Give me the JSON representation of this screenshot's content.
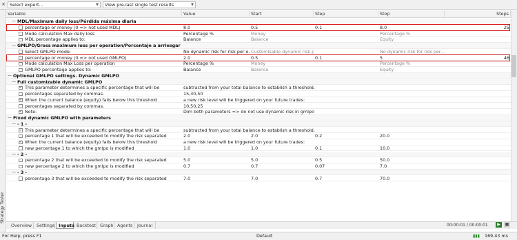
{
  "toolbar": {
    "close_glyph": "×",
    "expert_select": "Select expert...",
    "results_select": "View pre-last single test results"
  },
  "columns": {
    "variable": "Variable",
    "value": "Value",
    "start": "Start",
    "step": "Step",
    "stop": "Stop",
    "steps": "Steps"
  },
  "rows": [
    {
      "type": "group",
      "indent": 1,
      "name": "MDL/Maximum daily loss/Pérdida máxima diaria"
    },
    {
      "type": "param",
      "indent": 2,
      "checked": false,
      "name": "percentage or money (0 => not used MDL)",
      "value": "8.0",
      "start": "0.5",
      "step": "0.1",
      "stop": "8.0",
      "steps": "25",
      "highlight": true
    },
    {
      "type": "param",
      "indent": 2,
      "checked": false,
      "name": "Mode calculation Max daily loss",
      "value": "Percentage %",
      "start": "Money",
      "step": "",
      "stop": "Percentage %",
      "steps": "",
      "gray": true
    },
    {
      "type": "param",
      "indent": 2,
      "checked": false,
      "name": "MDL percentage applies to:",
      "value": "Balance",
      "start": "Balance",
      "step": "",
      "stop": "Equity",
      "steps": "",
      "gray": true
    },
    {
      "type": "group",
      "indent": 1,
      "name": "GMLPO/Gross maximum loss per operation/Porcentaje a arriesgar"
    },
    {
      "type": "param",
      "indent": 2,
      "checked": false,
      "name": "Select GMLPO mode:",
      "value": "No dynamic risk for risk per o...",
      "start": "Customisable dynamic risk p...",
      "step": "",
      "stop": "No dynamic risk for risk per...",
      "steps": "",
      "gray": true
    },
    {
      "type": "param",
      "indent": 2,
      "checked": false,
      "name": "percentage or money (0 => not used GMLPO)",
      "value": "2.0",
      "start": "0.5",
      "step": "0.1",
      "stop": "5",
      "steps": "46",
      "highlight": true
    },
    {
      "type": "param",
      "indent": 2,
      "checked": false,
      "name": "Mode calculation Max Loss per operation",
      "value": "Percentage %",
      "start": "Money",
      "step": "",
      "stop": "Percentage %",
      "steps": "",
      "gray": true
    },
    {
      "type": "param",
      "indent": 2,
      "checked": false,
      "name": "GMLPO percentage applies to:",
      "value": "Balance",
      "start": "Balance",
      "step": "",
      "stop": "Equity",
      "steps": "",
      "gray": true
    },
    {
      "type": "group",
      "indent": 0,
      "name": "Optional GMLPO settings. Dynamic GMLPO"
    },
    {
      "type": "group",
      "indent": 1,
      "name": "Full customizable dynamic GMLPO"
    },
    {
      "type": "param",
      "indent": 2,
      "checked": true,
      "name": "This parameter determines a specific percentage that will be",
      "value": "subtracted from your total balance to establish a threshold.",
      "start": "",
      "step": "",
      "stop": "",
      "steps": "",
      "wide": true
    },
    {
      "type": "param",
      "indent": 2,
      "checked": false,
      "name": "percentages separated by commas.",
      "value": "15,30,50",
      "start": "",
      "step": "",
      "stop": "",
      "steps": ""
    },
    {
      "type": "param",
      "indent": 2,
      "checked": true,
      "name": "When the current balance (equity) falls below this threshold",
      "value": "a new risk level will be triggered on your future trades:",
      "start": "",
      "step": "",
      "stop": "",
      "steps": "",
      "wide": true
    },
    {
      "type": "param",
      "indent": 2,
      "checked": false,
      "name": "percentages separated by commas.",
      "value": "10,50,25",
      "start": "",
      "step": "",
      "stop": "",
      "steps": ""
    },
    {
      "type": "param",
      "indent": 2,
      "checked": true,
      "name": "Note:",
      "value": "Dim both parameters => do not use dynamic risk in gmlpo",
      "start": "",
      "step": "",
      "stop": "",
      "steps": "",
      "wide": true
    },
    {
      "type": "group",
      "indent": 0,
      "name": "Fixed dynamic GMLPO with parameters"
    },
    {
      "type": "group",
      "indent": 1,
      "name": "- 1 -"
    },
    {
      "type": "param",
      "indent": 2,
      "checked": true,
      "name": "This parameter determines a specific percentage that will be",
      "value": "subtracted from your total balance to establish a threshold.",
      "start": "",
      "step": "",
      "stop": "",
      "steps": "",
      "wide": true
    },
    {
      "type": "param",
      "indent": 2,
      "checked": false,
      "name": "percentage 1 that will be exceeded to modify the risk separated",
      "value": "2.0",
      "start": "2.0",
      "step": "0.2",
      "stop": "20.0",
      "steps": ""
    },
    {
      "type": "param",
      "indent": 2,
      "checked": true,
      "name": "When the current balance (equity) falls below this threshold",
      "value": "a new risk level will be triggered on your future trades:",
      "start": "",
      "step": "",
      "stop": "",
      "steps": "",
      "wide": true
    },
    {
      "type": "param",
      "indent": 2,
      "checked": false,
      "name": "new percentage 1 to which the gmlpo is modified",
      "value": "1.0",
      "start": "1.0",
      "step": "0.1",
      "stop": "10.0",
      "steps": ""
    },
    {
      "type": "group",
      "indent": 1,
      "name": "- 2 -"
    },
    {
      "type": "param",
      "indent": 2,
      "checked": false,
      "name": "percentage 2 that will be exceeded to modify the risk separated",
      "value": "5.0",
      "start": "5.0",
      "step": "0.5",
      "stop": "50.0",
      "steps": ""
    },
    {
      "type": "param",
      "indent": 2,
      "checked": false,
      "name": "new percentage 2 to which the gmlpo is modified",
      "value": "0.7",
      "start": "0.7",
      "step": "0.07",
      "stop": "7.0",
      "steps": ""
    },
    {
      "type": "group",
      "indent": 1,
      "name": "- 3 -"
    },
    {
      "type": "param",
      "indent": 2,
      "checked": false,
      "name": "percentage 3 that will be exceeded to modify the risk separated",
      "value": "7.0",
      "start": "7.0",
      "step": "0.7",
      "stop": "70.0",
      "steps": ""
    }
  ],
  "side_label": "Strategy Tester",
  "tabs": [
    {
      "label": "Overview",
      "active": false
    },
    {
      "label": "Settings",
      "active": false
    },
    {
      "label": "Inputs",
      "active": true
    },
    {
      "label": "Backtest",
      "active": false
    },
    {
      "label": "Graph",
      "active": false
    },
    {
      "label": "Agents",
      "active": false
    },
    {
      "label": "Journal",
      "active": false
    }
  ],
  "timer": "00:00:01 / 00:00:01",
  "status": {
    "help": "For Help, press F1",
    "profile": "Default",
    "memory": "169.43 ms"
  }
}
